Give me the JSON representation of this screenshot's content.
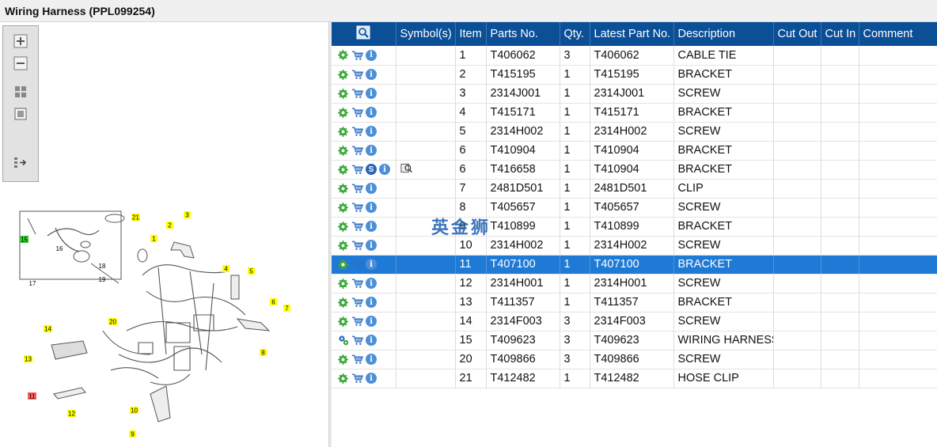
{
  "window": {
    "title": "Wiring Harness (PPL099254)"
  },
  "toolbox": {
    "items": [
      {
        "name": "zoom-in-button",
        "icon": "plus-icon"
      },
      {
        "name": "zoom-out-button",
        "icon": "minus-icon"
      },
      {
        "name": "fit-all-button",
        "icon": "fit-all-icon"
      },
      {
        "name": "actual-size-button",
        "icon": "square-icon"
      },
      {
        "name": "toggle-list-button",
        "icon": "list-arrow-icon"
      }
    ]
  },
  "diagram": {
    "callouts": [
      "1",
      "2",
      "3",
      "4",
      "5",
      "6",
      "7",
      "8",
      "9",
      "10",
      "11",
      "12",
      "13",
      "14",
      "15",
      "16",
      "17",
      "18",
      "19",
      "20",
      "21"
    ],
    "callout_colors": {
      "normal": "#ffff00",
      "selected": "#ff5a5a",
      "group": "#33cc33"
    }
  },
  "table": {
    "columns": [
      "",
      "Symbol(s)",
      "Item",
      "Parts No.",
      "Qty.",
      "Latest Part No.",
      "Description",
      "Cut Out",
      "Cut In",
      "Comment"
    ],
    "rows": [
      {
        "item": "1",
        "part": "T406062",
        "qty": "3",
        "latest": "T406062",
        "desc": "CABLE TIE"
      },
      {
        "item": "2",
        "part": "T415195",
        "qty": "1",
        "latest": "T415195",
        "desc": "BRACKET"
      },
      {
        "item": "3",
        "part": "2314J001",
        "qty": "1",
        "latest": "2314J001",
        "desc": "SCREW"
      },
      {
        "item": "4",
        "part": "T415171",
        "qty": "1",
        "latest": "T415171",
        "desc": "BRACKET"
      },
      {
        "item": "5",
        "part": "2314H002",
        "qty": "1",
        "latest": "2314H002",
        "desc": "SCREW"
      },
      {
        "item": "6",
        "part": "T410904",
        "qty": "1",
        "latest": "T410904",
        "desc": "BRACKET"
      },
      {
        "item": "6",
        "part": "T416658",
        "qty": "1",
        "latest": "T410904",
        "desc": "BRACKET"
      },
      {
        "item": "7",
        "part": "2481D501",
        "qty": "1",
        "latest": "2481D501",
        "desc": "CLIP"
      },
      {
        "item": "8",
        "part": "T405657",
        "qty": "1",
        "latest": "T405657",
        "desc": "SCREW"
      },
      {
        "item": "9",
        "part": "T410899",
        "qty": "1",
        "latest": "T410899",
        "desc": "BRACKET"
      },
      {
        "item": "10",
        "part": "2314H002",
        "qty": "1",
        "latest": "2314H002",
        "desc": "SCREW"
      },
      {
        "item": "11",
        "part": "T407100",
        "qty": "1",
        "latest": "T407100",
        "desc": "BRACKET"
      },
      {
        "item": "12",
        "part": "2314H001",
        "qty": "1",
        "latest": "2314H001",
        "desc": "SCREW"
      },
      {
        "item": "13",
        "part": "T411357",
        "qty": "1",
        "latest": "T411357",
        "desc": "BRACKET"
      },
      {
        "item": "14",
        "part": "2314F003",
        "qty": "3",
        "latest": "2314F003",
        "desc": "SCREW"
      },
      {
        "item": "15",
        "part": "T409623",
        "qty": "3",
        "latest": "T409623",
        "desc": "WIRING HARNESS"
      },
      {
        "item": "20",
        "part": "T409866",
        "qty": "3",
        "latest": "T409866",
        "desc": "SCREW"
      },
      {
        "item": "21",
        "part": "T412482",
        "qty": "1",
        "latest": "T412482",
        "desc": "HOSE CLIP"
      }
    ]
  },
  "watermark": "英金狮",
  "colors": {
    "header_bg": "#0b4f96",
    "selected_row": "#1f7ad6",
    "gear": "#3aa83a",
    "cart": "#2d6fc4"
  }
}
